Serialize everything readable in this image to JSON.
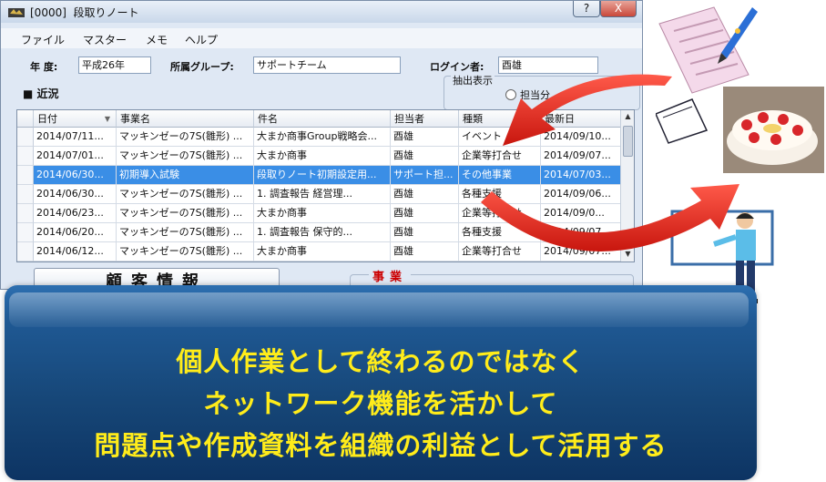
{
  "window": {
    "title": "[0000]  段取りノート",
    "help_button": "?",
    "close_button": "X"
  },
  "menu": [
    {
      "label": "ファイル"
    },
    {
      "label": "マスター"
    },
    {
      "label": "メモ"
    },
    {
      "label": "ヘルプ"
    }
  ],
  "fields": {
    "year_label": "年 度:",
    "year_value": "平成26年",
    "group_label": "所属グループ:",
    "group_value": "サポートチーム",
    "login_label": "ログイン者:",
    "login_value": "酉雄"
  },
  "section_title": "■ 近況",
  "extract": {
    "legend": "抽出表示",
    "radio_label": "担当分"
  },
  "table": {
    "headers": [
      "日付",
      "事業名",
      "件名",
      "担当者",
      "種類",
      "最新日"
    ],
    "rows": [
      [
        "2014/07/11...",
        "マッキンゼーの7S(雛形) ...",
        "大まか商事Group戦略会...",
        "酉雄",
        "イベント",
        "2014/09/10..."
      ],
      [
        "2014/07/01...",
        "マッキンゼーの7S(雛形) ...",
        "大まか商事",
        "酉雄",
        "企業等打合せ",
        "2014/09/07..."
      ],
      [
        "2014/06/30...",
        "初期導入試験",
        "段取りノート初期設定用...",
        "サポート担...",
        "その他事業",
        "2014/07/03..."
      ],
      [
        "2014/06/30...",
        "マッキンゼーの7S(雛形) ...",
        "1. 調査報告 経営理...",
        "酉雄",
        "各種支援",
        "2014/09/06..."
      ],
      [
        "2014/06/23...",
        "マッキンゼーの7S(雛形) ...",
        "大まか商事",
        "酉雄",
        "企業等打合せ",
        "2014/09/0..."
      ],
      [
        "2014/06/20...",
        "マッキンゼーの7S(雛形) ...",
        "1. 調査報告 保守的...",
        "酉雄",
        "各種支援",
        "2014/09/07..."
      ],
      [
        "2014/06/12...",
        "マッキンゼーの7S(雛形) ...",
        "大まか商事",
        "酉雄",
        "企業等打合せ",
        "2014/09/07..."
      ]
    ],
    "selected_row": 2
  },
  "kokyaku_label": "顧客情報",
  "jigyo_label": "事業",
  "banner": {
    "line1": "個人作業として終わるのではなく",
    "line2": "ネットワーク機能を活かして",
    "line3": "問題点や作成資料を組織の利益として活用する"
  },
  "colors": {
    "banner_text": "#ffec1a",
    "selected_row": "#3a8ee6",
    "arrow": "#e0241c"
  },
  "icons": [
    "app-icon",
    "pen-note-icon",
    "cake-icon",
    "presenter-icon",
    "curved-arrow-icon"
  ]
}
